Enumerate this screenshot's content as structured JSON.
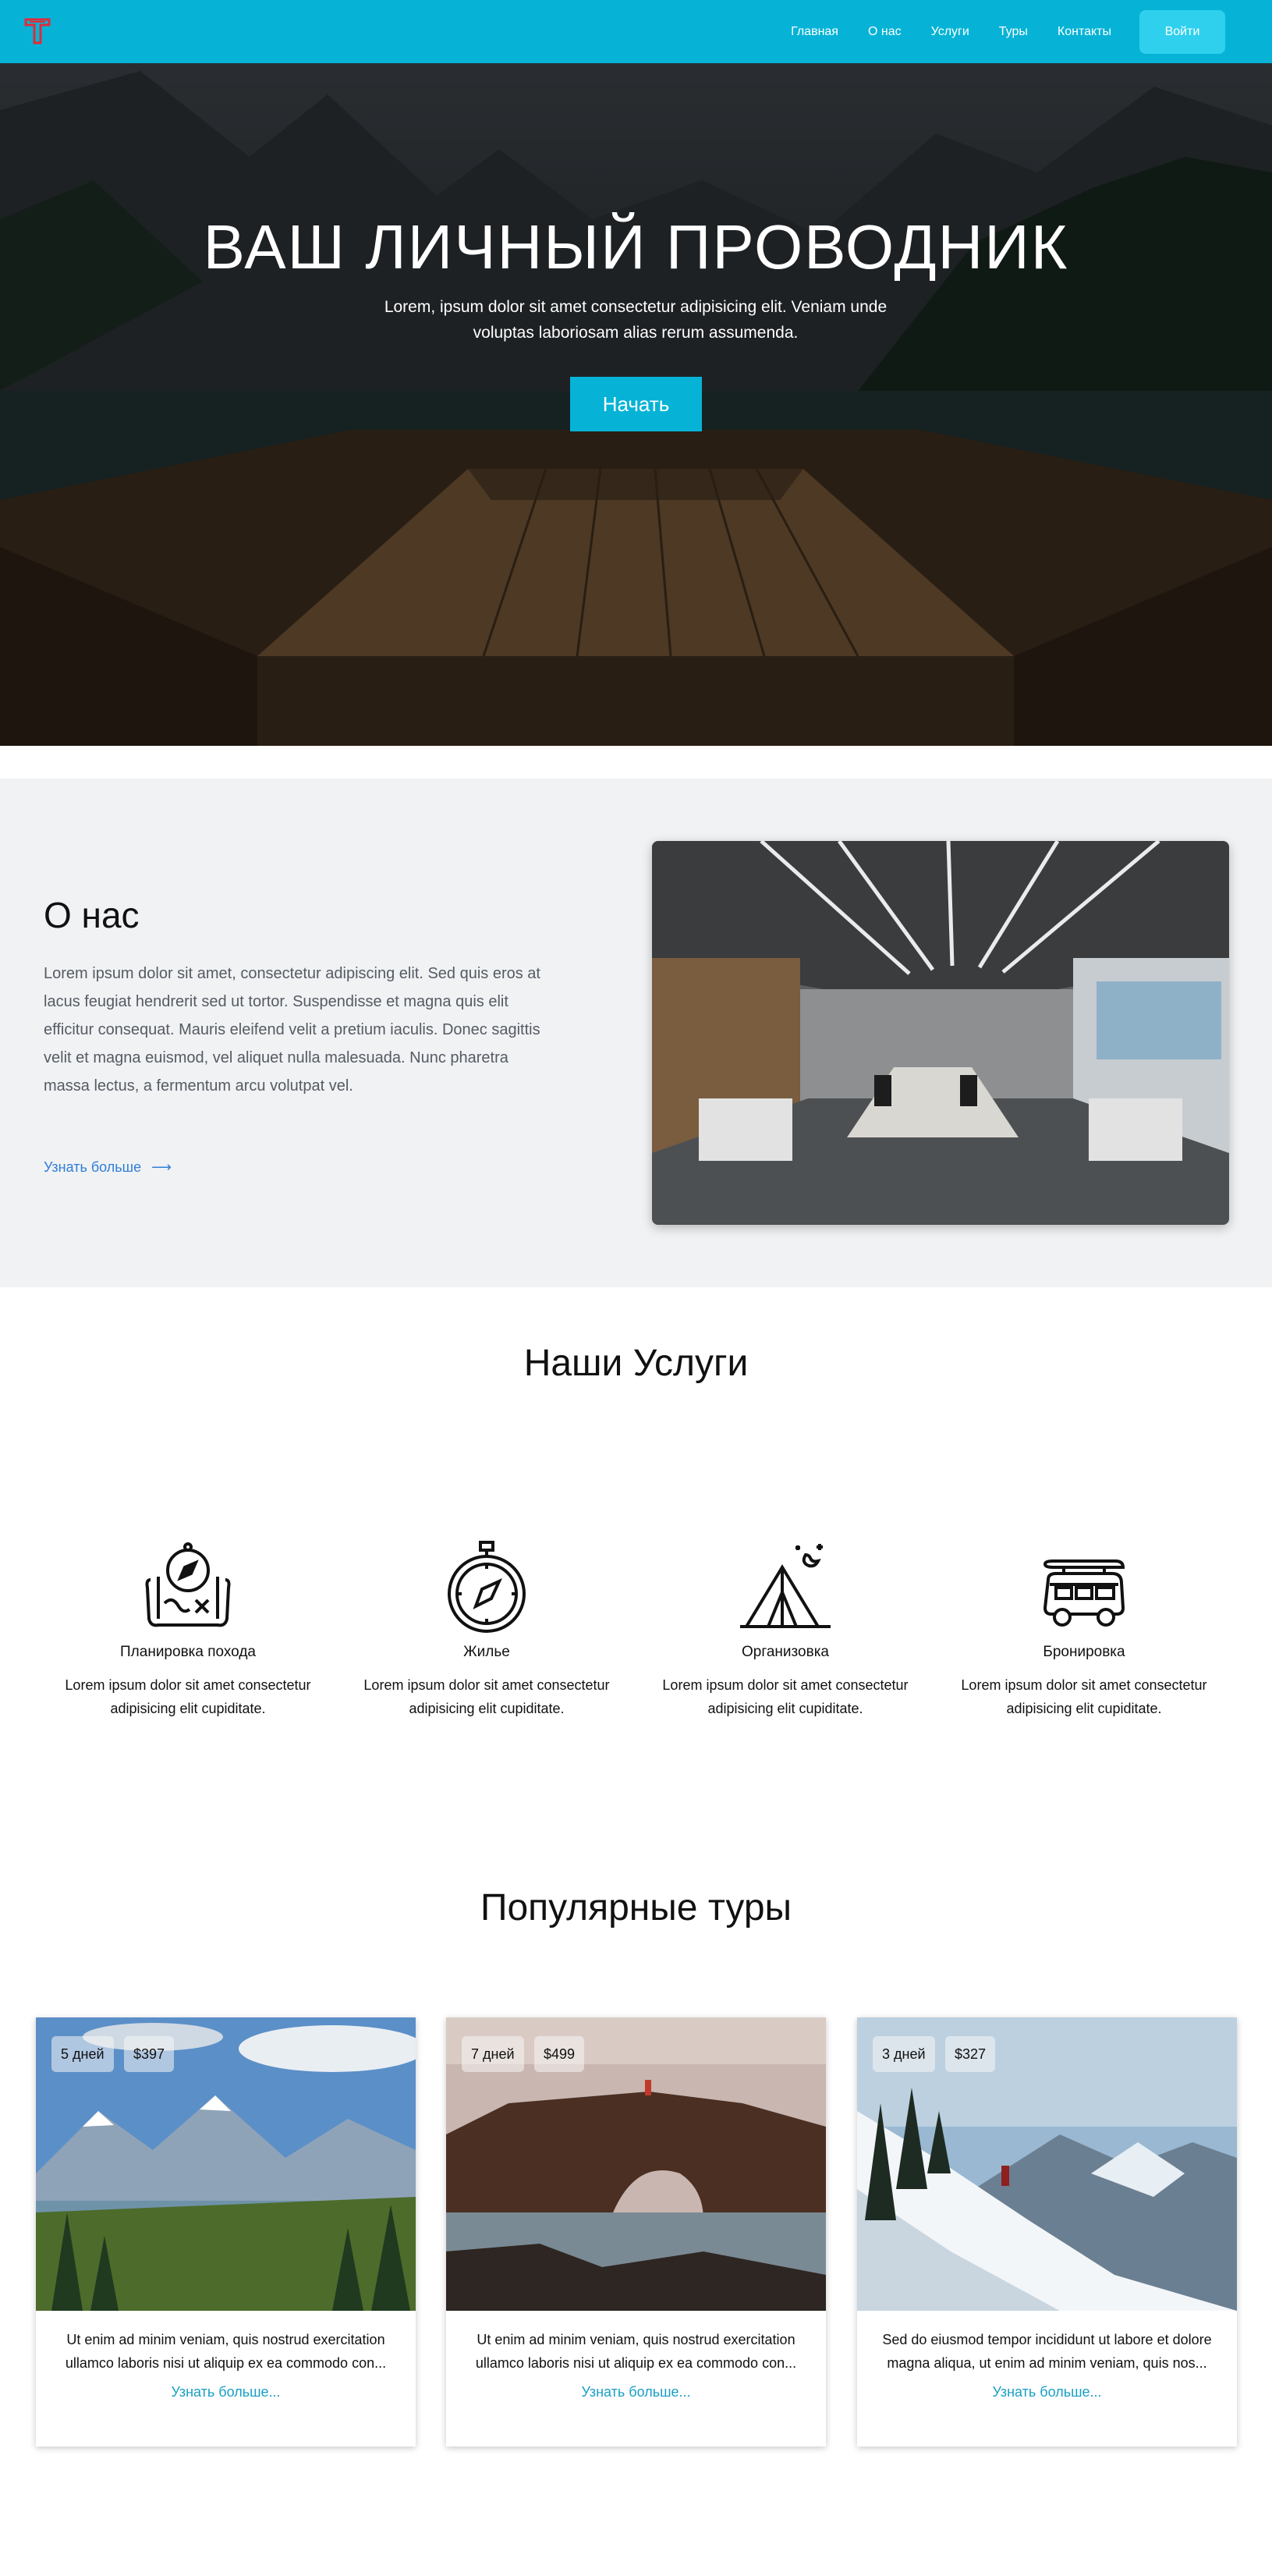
{
  "header": {
    "nav": [
      "Главная",
      "О нас",
      "Услуги",
      "Туры",
      "Контакты"
    ],
    "login": "Войти",
    "colors": {
      "bar": "#06b3d6",
      "login": "#2fd0ee",
      "logo": "#e02b3a"
    }
  },
  "hero": {
    "title": "ВАШ ЛИЧНЫЙ ПРОВОДНИК",
    "subtitle": "Lorem, ipsum dolor sit amet consectetur adipisicing elit. Veniam unde voluptas laboriosam alias rerum assumenda.",
    "button": "Начать"
  },
  "about": {
    "title": "О нас",
    "text": "Lorem ipsum dolor sit amet, consectetur adipiscing elit. Sed quis eros at lacus feugiat hendrerit sed ut tortor. Suspendisse et magna quis elit efficitur consequat. Mauris eleifend velit a pretium iaculis. Donec sagittis velit et magna euismod, vel aliquet nulla malesuada. Nunc pharetra massa lectus, a fermentum arcu volutpat vel.",
    "link": "Узнать больше",
    "link_arrow": "⟶"
  },
  "services": {
    "title": "Наши Услуги",
    "items": [
      {
        "icon": "map-compass-icon",
        "name": "Планировка похода",
        "desc": "Lorem ipsum dolor sit amet consectetur adipisicing elit cupiditate."
      },
      {
        "icon": "compass-icon",
        "name": "Жилье",
        "desc": "Lorem ipsum dolor sit amet consectetur adipisicing elit cupiditate."
      },
      {
        "icon": "tent-icon",
        "name": "Организовка",
        "desc": "Lorem ipsum dolor sit amet consectetur adipisicing elit cupiditate."
      },
      {
        "icon": "camper-van-icon",
        "name": "Бронировка",
        "desc": "Lorem ipsum dolor sit amet consectetur adipisicing elit cupiditate."
      }
    ]
  },
  "tours": {
    "title": "Популярные туры",
    "cards": [
      {
        "days": "5 дней",
        "price": "$397",
        "text": "Ut enim ad minim veniam, quis nostrud exercitation ullamco laboris nisi ut aliquip ex ea commodo con...",
        "link": "Узнать больше..."
      },
      {
        "days": "7 дней",
        "price": "$499",
        "text": "Ut enim ad minim veniam, quis nostrud exercitation ullamco laboris nisi ut aliquip ex ea commodo con...",
        "link": "Узнать больше..."
      },
      {
        "days": "3 дней",
        "price": "$327",
        "text": "Sed do eiusmod tempor incididunt ut labore et dolore magna aliqua, ut enim ad minim veniam, quis nos...",
        "link": "Узнать больше..."
      }
    ]
  }
}
